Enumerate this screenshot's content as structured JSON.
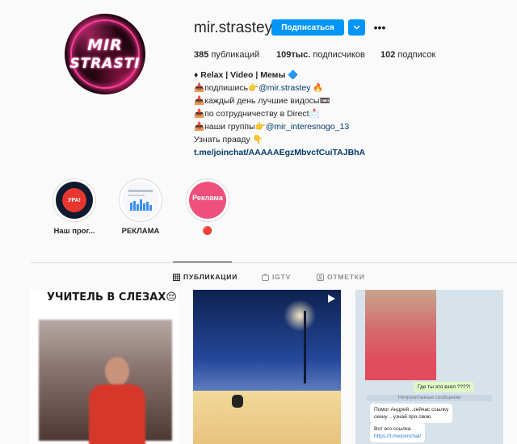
{
  "profile": {
    "avatar_text_line1": "MIR",
    "avatar_text_line2": "STRASTI",
    "username": "mir.strastey",
    "follow_label": "Подписаться",
    "more_label": "•••"
  },
  "stats": {
    "posts_count": "385",
    "posts_label": "публикаций",
    "followers_count": "109тыс.",
    "followers_label": "подписчиков",
    "following_count": "102",
    "following_label": "подписок"
  },
  "bio": {
    "title": "♦ Relax | Video | Мемы 🔷",
    "line2_text": "📥подпишись👉",
    "line2_mention": "@mir.strastey",
    "line2_suffix": " 🔥",
    "line3": "📥каждый день лучшие видосы📼",
    "line4": "📥по сотрудничеству в Direct📩",
    "line5_text": "📥наши группы👉",
    "line5_mention": "@mir_interesnogo_13",
    "line6": "Узнать правду 👇",
    "link": "t.me/joinchat/AAAAAEgzMbvcfCuiTAJBhA"
  },
  "highlights": [
    {
      "label": "Наш прог...",
      "badge_text": "УРА!"
    },
    {
      "label": "РЕКЛАМА"
    },
    {
      "label": "🔴",
      "inner_text": "Реклама"
    }
  ],
  "tabs": {
    "posts": "ПУБЛИКАЦИИ",
    "igtv": "IGTV",
    "tagged": "ОТМЕТКИ"
  },
  "posts": {
    "p1_caption": "УЧИТЕЛЬ В СЛЕЗАХ😔",
    "p3_msg1": "Где ты это взял ????!",
    "p3_unread": "Непрочитанные сообщения",
    "p3_msg2_line1": "Помог Андрей ..сейчас ссылку",
    "p3_msg2_line2": "скину .. узнай про свою",
    "p3_msg3_line1": "Вот его ссылка",
    "p3_msg3_url": "https://t.me/joinchat/"
  },
  "colors": {
    "accent": "#0095f6",
    "link": "#00376b",
    "background": "#fafafa"
  }
}
